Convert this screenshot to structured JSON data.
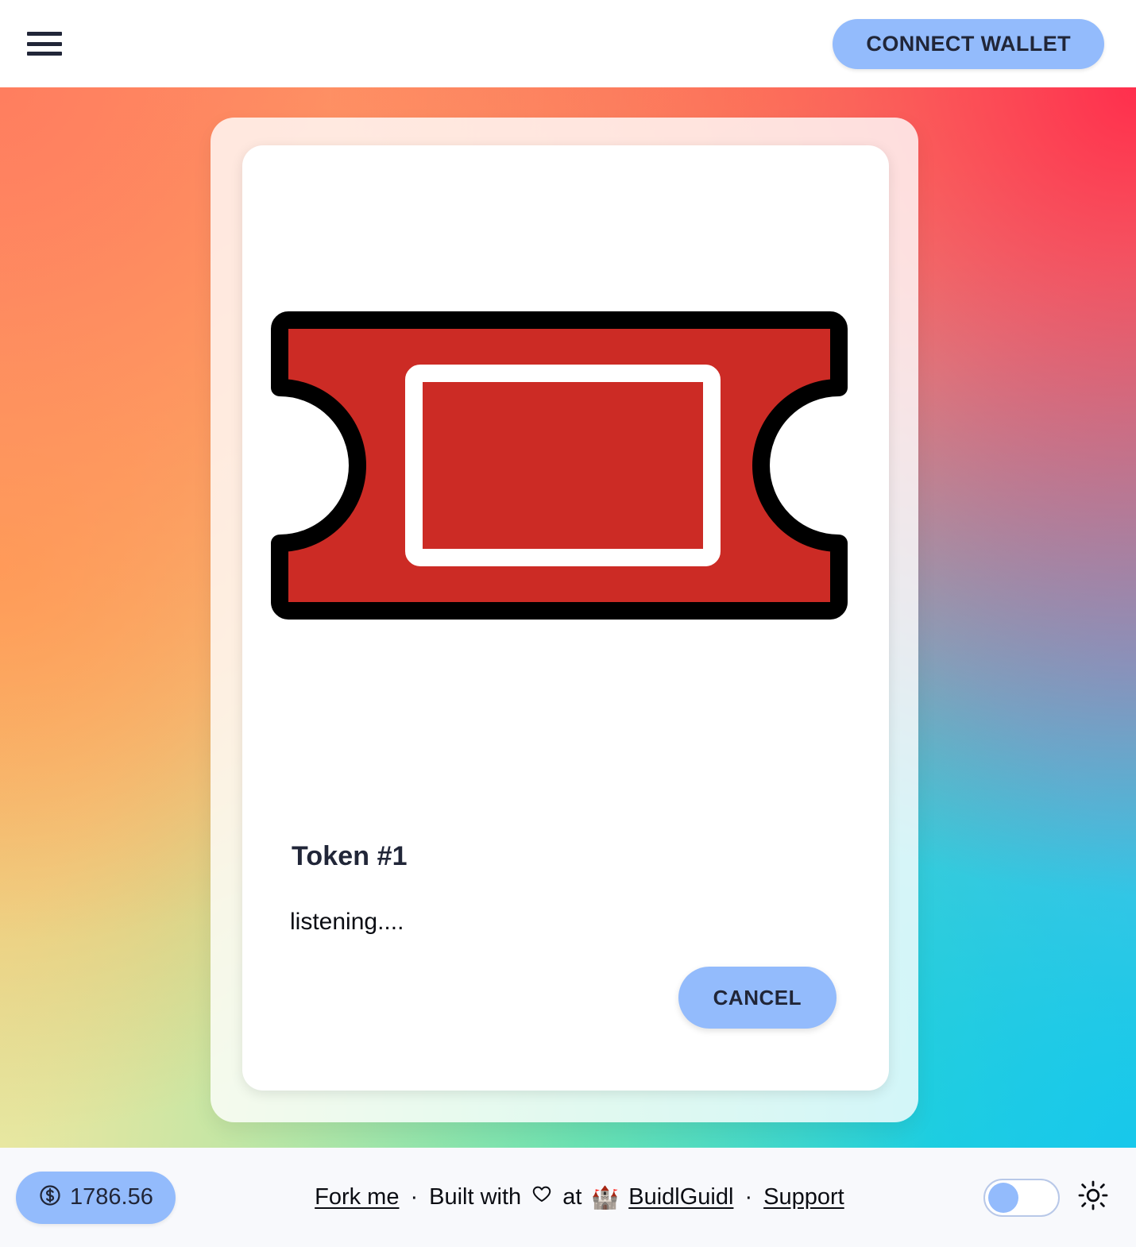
{
  "header": {
    "menu_icon": "hamburger-menu-icon",
    "connect_wallet_label": "CONNECT WALLET"
  },
  "card": {
    "art_icon": "ticket-icon",
    "title": "Token #1",
    "status_text": "listening....",
    "cancel_label": "CANCEL"
  },
  "footer": {
    "price_icon": "circled-dollar-icon",
    "price_value": "1786.56",
    "fork_me_label": "Fork me",
    "dot_1": "·",
    "built_with_label": "Built with",
    "heart_icon": "heart-outline-icon",
    "at_label": "at",
    "castle_icon": "🏰",
    "buidlguidl_label": "BuidlGuidl",
    "dot_2": "·",
    "support_label": "Support",
    "theme_toggle_icon": "theme-toggle-switch",
    "sun_icon": "sun-icon"
  },
  "colors": {
    "accent_blue": "#93BBFC",
    "text_dark": "#212638",
    "ticket_red": "#CC2B25",
    "ticket_outline": "#000000",
    "footer_bg": "#F8F9FC",
    "gradient_top_left": "#FF7E5F",
    "gradient_top_right": "#FF2F4D",
    "gradient_bottom_left": "#E8E7A0",
    "gradient_bottom_right": "#18C8EB",
    "gradient_bottom_mid": "#21EAA0"
  }
}
